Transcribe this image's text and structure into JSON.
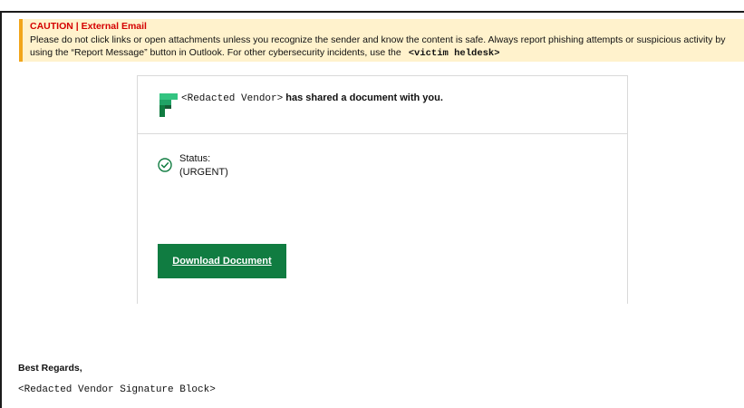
{
  "banner": {
    "title": "CAUTION | External Email",
    "body_text": "Please do not click links or open attachments unless you recognize the sender and know the content is safe. Always report phishing attempts or suspicious activity by using the “Report Message” button in Outlook. For other cybersecurity incidents, use the",
    "helpdesk": "<victim heldesk>",
    "accent_color": "#f2a51a",
    "background_color": "#fff2cc",
    "title_color": "#d40000"
  },
  "card": {
    "logo_icon": "green-document-logo-icon",
    "vendor": "<Redacted Vendor>",
    "shared_text": "has shared a document with you.",
    "status_icon": "check-circle-icon",
    "status_label": "Status:",
    "status_value": "(URGENT)",
    "download_label": "Download Document",
    "button_color": "#107c41"
  },
  "footer": {
    "regards": "Best Regards,",
    "signature": "<Redacted Vendor Signature Block>"
  }
}
